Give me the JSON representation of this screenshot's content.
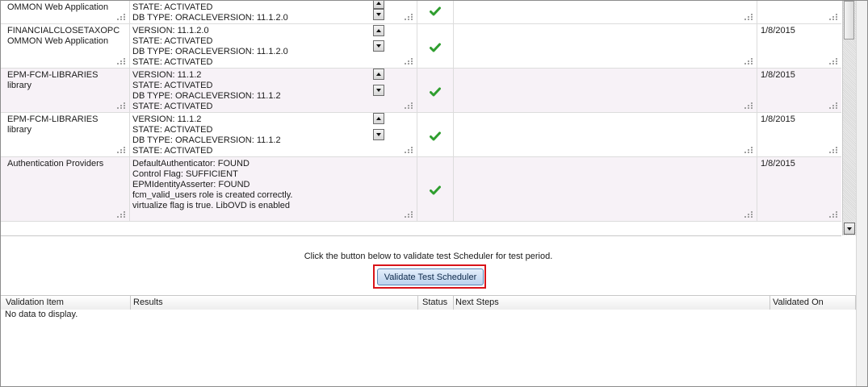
{
  "environment_rows": [
    {
      "item": [
        "OMMON Web Application"
      ],
      "results": [
        "STATE: ACTIVATED",
        "DB TYPE: ORACLEVERSION: 11.1.2.0",
        "STATE: ACTIVATED"
      ],
      "status_icon": "check-icon",
      "validated_on": ""
    },
    {
      "item": [
        "FINANCIALCLOSETAXOPC",
        "OMMON Web Application"
      ],
      "results": [
        "VERSION: 11.1.2.0",
        "STATE: ACTIVATED",
        "DB TYPE: ORACLEVERSION: 11.1.2.0",
        "STATE: ACTIVATED"
      ],
      "status_icon": "check-icon",
      "validated_on": "1/8/2015"
    },
    {
      "item": [
        "EPM-FCM-LIBRARIES",
        "library"
      ],
      "results": [
        "VERSION: 11.1.2",
        "STATE: ACTIVATED",
        "DB TYPE: ORACLEVERSION: 11.1.2",
        "STATE: ACTIVATED"
      ],
      "status_icon": "check-icon",
      "validated_on": "1/8/2015"
    },
    {
      "item": [
        "EPM-FCM-LIBRARIES",
        "library"
      ],
      "results": [
        "VERSION: 11.1.2",
        "STATE: ACTIVATED",
        "DB TYPE: ORACLEVERSION: 11.1.2",
        "STATE: ACTIVATED"
      ],
      "status_icon": "check-icon",
      "validated_on": "1/8/2015"
    },
    {
      "item": [
        "Authentication Providers"
      ],
      "results": [
        "DefaultAuthenticator: FOUND",
        "Control Flag: SUFFICIENT",
        "EPMIdentityAsserter: FOUND",
        "fcm_valid_users role is created correctly.",
        "virtualize flag is true. LibOVD is enabled"
      ],
      "status_icon": "check-icon",
      "validated_on": "1/8/2015"
    }
  ],
  "scheduler": {
    "instruction": "Click the button below to validate test Scheduler for test period.",
    "button_label": "Validate Test Scheduler"
  },
  "scheduler_table": {
    "columns": [
      "Validation Item",
      "Results",
      "Status",
      "Next Steps",
      "Validated On"
    ],
    "empty_text": "No data to display."
  },
  "colors": {
    "check_green": "#2f9e2f",
    "highlight_red": "#d9141a",
    "alt_row": "#f7f2f7"
  }
}
